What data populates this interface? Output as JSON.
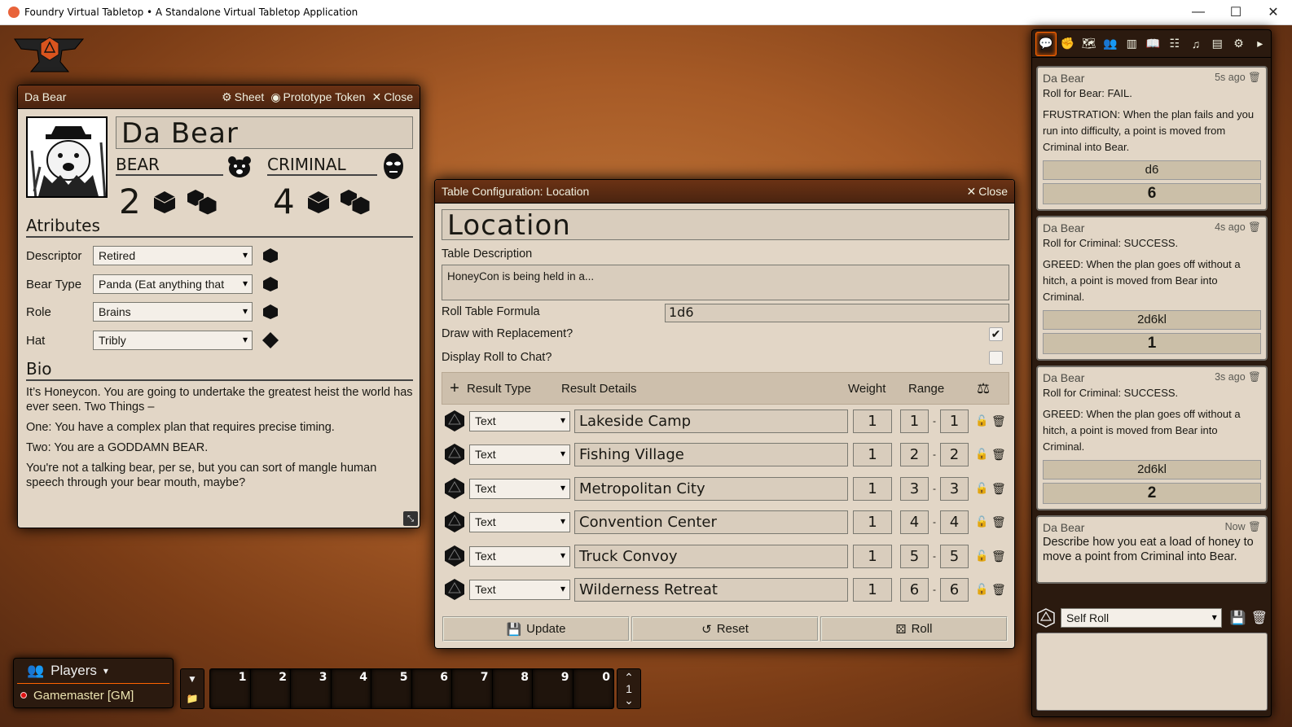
{
  "window": {
    "title": "Foundry Virtual Tabletop • A Standalone Virtual Tabletop Application",
    "minimize": "—",
    "maximize": "☐",
    "close": "✕"
  },
  "actor": {
    "window_title": "Da Bear",
    "sheet_label": "Sheet",
    "prototype_label": "Prototype Token",
    "close_label": "Close",
    "name": "Da Bear",
    "bear_label": "BEAR",
    "bear_value": "2",
    "criminal_label": "CRIMINAL",
    "criminal_value": "4",
    "attributes_title": "Atributes",
    "attributes": [
      {
        "label": "Descriptor",
        "value": "Retired"
      },
      {
        "label": "Bear Type",
        "value": "Panda (Eat anything that"
      },
      {
        "label": "Role",
        "value": "Brains"
      },
      {
        "label": "Hat",
        "value": "Tribly"
      }
    ],
    "bio_title": "Bio",
    "bio": [
      "It’s Honeycon. You are going to undertake the greatest heist the world has ever seen. Two Things –",
      "One: You have a complex plan that requires precise timing.",
      "Two: You are a GODDAMN BEAR.",
      "You're not a talking bear, per se, but you can sort of mangle human speech through your bear mouth, maybe?"
    ]
  },
  "table": {
    "window_title": "Table Configuration: Location",
    "close_label": "Close",
    "name": "Location",
    "description_label": "Table Description",
    "description": "HoneyCon is being held in a...",
    "formula_label": "Roll Table Formula",
    "formula": "1d6",
    "replacement_label": "Draw with Replacement?",
    "replacement_checked": "✔",
    "display_label": "Display Roll to Chat?",
    "headers": {
      "add": "+",
      "type": "Result Type",
      "details": "Result Details",
      "weight": "Weight",
      "range": "Range",
      "balance": "⚖"
    },
    "results": [
      {
        "type": "Text",
        "text": "Lakeside Camp",
        "weight": "1",
        "low": "1",
        "high": "1"
      },
      {
        "type": "Text",
        "text": "Fishing Village",
        "weight": "1",
        "low": "2",
        "high": "2"
      },
      {
        "type": "Text",
        "text": "Metropolitan City",
        "weight": "1",
        "low": "3",
        "high": "3"
      },
      {
        "type": "Text",
        "text": "Convention Center",
        "weight": "1",
        "low": "4",
        "high": "4"
      },
      {
        "type": "Text",
        "text": "Truck Convoy",
        "weight": "1",
        "low": "5",
        "high": "5"
      },
      {
        "type": "Text",
        "text": "Wilderness Retreat",
        "weight": "1",
        "low": "6",
        "high": "6"
      }
    ],
    "update_label": "Update",
    "reset_label": "Reset",
    "roll_label": "Roll"
  },
  "chat": {
    "messages": [
      {
        "speaker": "Da Bear",
        "time": "5s ago",
        "flavor": "Roll for Bear: FAIL.",
        "text": "FRUSTRATION: When the plan fails and you run into difficulty, a point is moved from Criminal into Bear.",
        "formula": "d6",
        "total": "6"
      },
      {
        "speaker": "Da Bear",
        "time": "4s ago",
        "flavor": "Roll for Criminal: SUCCESS.",
        "text": "GREED: When the plan goes off without a hitch, a point is moved from Bear into Criminal.",
        "formula": "2d6kl",
        "total": "1"
      },
      {
        "speaker": "Da Bear",
        "time": "3s ago",
        "flavor": "Roll for Criminal: SUCCESS.",
        "text": "GREED: When the plan goes off without a hitch, a point is moved from Bear into Criminal.",
        "formula": "2d6kl",
        "total": "2"
      },
      {
        "speaker": "Da Bear",
        "time": "Now",
        "text": "Describe how you eat a load of honey to move a point from Criminal into Bear."
      }
    ],
    "roll_mode": "Self Roll"
  },
  "players": {
    "title": "Players",
    "list": [
      {
        "name": "Gamemaster [GM]"
      }
    ]
  },
  "hotbar": {
    "slots": [
      "1",
      "2",
      "3",
      "4",
      "5",
      "6",
      "7",
      "8",
      "9",
      "0"
    ],
    "page": "1"
  },
  "colors": {
    "accent": "#ff6400",
    "window_bg": "#e2d6c6",
    "header_bg": "#4a2410"
  }
}
